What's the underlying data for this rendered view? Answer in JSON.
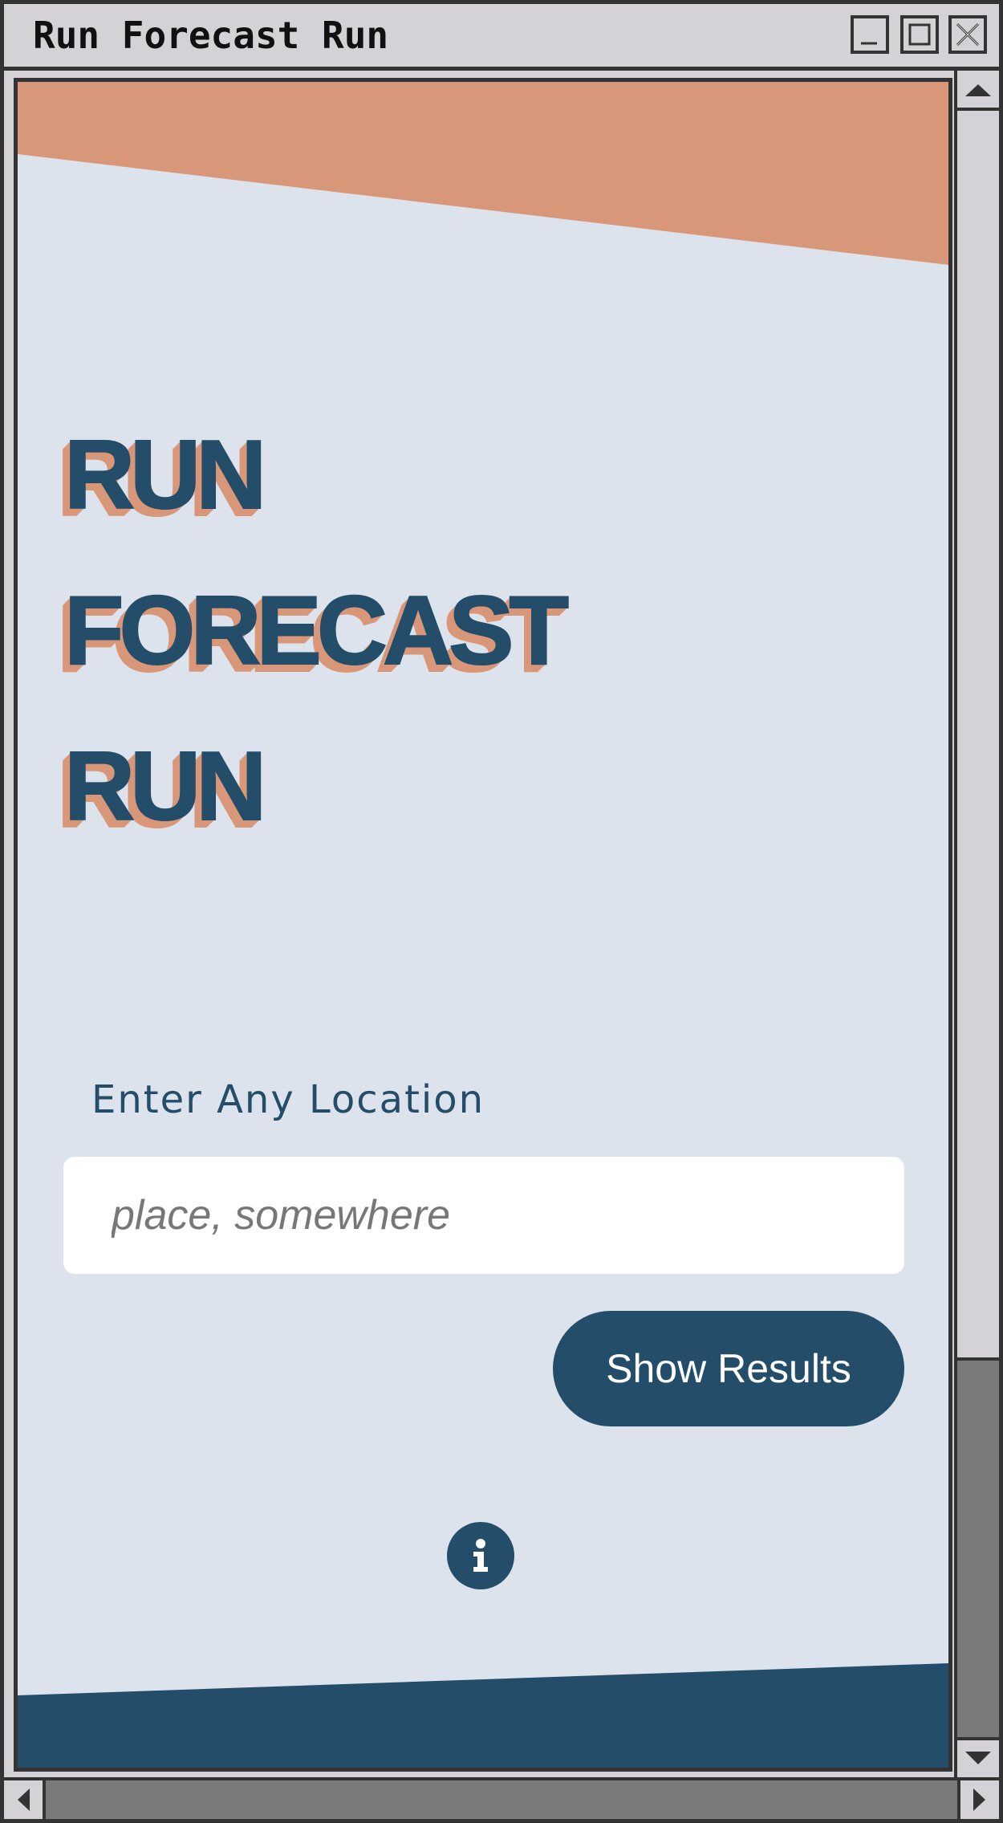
{
  "window": {
    "title": "Run Forecast Run",
    "minimize_icon": "minimize-icon",
    "maximize_icon": "maximize-icon",
    "close_icon": "close-icon"
  },
  "hero": {
    "line1": "RUN",
    "line2": "FORECAST",
    "line3": "RUN"
  },
  "search": {
    "label": "Enter Any Location",
    "placeholder": "place, somewhere",
    "value": ""
  },
  "actions": {
    "show_results_label": "Show Results",
    "info_icon": "info-icon"
  },
  "colors": {
    "background": "#dce3ec",
    "accent_orange": "#d99779",
    "primary_navy": "#234d68",
    "chrome": "#d4d2d6"
  }
}
